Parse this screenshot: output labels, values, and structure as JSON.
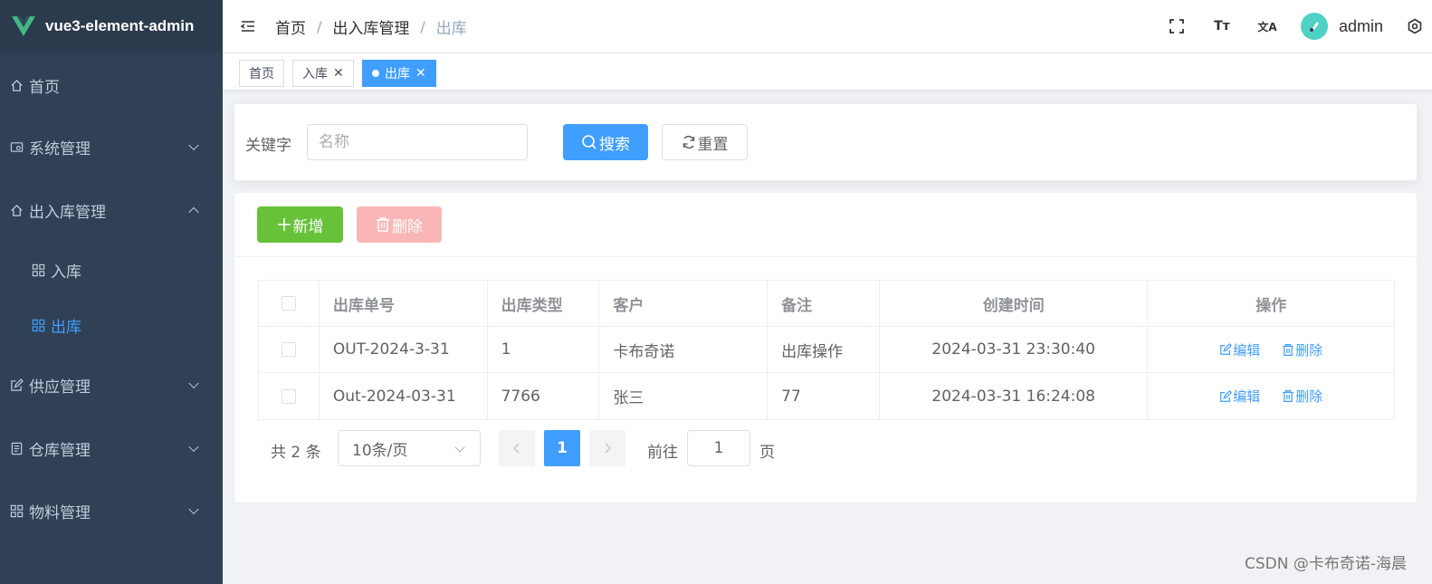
{
  "app": {
    "title": "vue3-element-admin"
  },
  "sidebar": {
    "items": [
      {
        "label": "首页",
        "icon": "home-icon"
      },
      {
        "label": "系统管理",
        "icon": "system-icon"
      },
      {
        "label": "出入库管理",
        "icon": "home-icon"
      },
      {
        "label": "入库",
        "icon": "grid-icon"
      },
      {
        "label": "出库",
        "icon": "grid-icon"
      },
      {
        "label": "供应管理",
        "icon": "edit-icon"
      },
      {
        "label": "仓库管理",
        "icon": "document-icon"
      },
      {
        "label": "物料管理",
        "icon": "grid-icon"
      }
    ]
  },
  "header": {
    "breadcrumb": [
      "首页",
      "出入库管理",
      "出库"
    ],
    "username": "admin",
    "size_icon_text": "Tт",
    "lang_icon_text": "文A"
  },
  "tags": [
    {
      "label": "首页"
    },
    {
      "label": "入库"
    },
    {
      "label": "出库"
    }
  ],
  "search": {
    "label": "关键字",
    "placeholder": "名称",
    "value": "",
    "search_button": "搜索",
    "reset_button": "重置"
  },
  "toolbar": {
    "add_button": "新增",
    "delete_button": "删除"
  },
  "table": {
    "columns": [
      "出库单号",
      "出库类型",
      "客户",
      "备注",
      "创建时间",
      "操作"
    ],
    "rows": [
      {
        "code": "OUT-2024-3-31",
        "type": "1",
        "customer": "卡布奇诺",
        "remark": "出库操作",
        "created": "2024-03-31 23:30:40",
        "edit": "编辑",
        "delete": "删除"
      },
      {
        "code": "Out-2024-03-31",
        "type": "7766",
        "customer": "张三",
        "remark": "77",
        "created": "2024-03-31 16:24:08",
        "edit": "编辑",
        "delete": "删除"
      }
    ]
  },
  "pagination": {
    "total_text": "共 2 条",
    "page_size": "10条/页",
    "current_page": "1",
    "goto_label": "前往",
    "goto_value": "1",
    "page_suffix": "页"
  },
  "watermark": "CSDN @卡布奇诺-海晨",
  "colors": {
    "sidebar_bg": "#304156",
    "primary": "#409eff",
    "success": "#67c23a",
    "danger_disabled": "#fab6b6"
  }
}
